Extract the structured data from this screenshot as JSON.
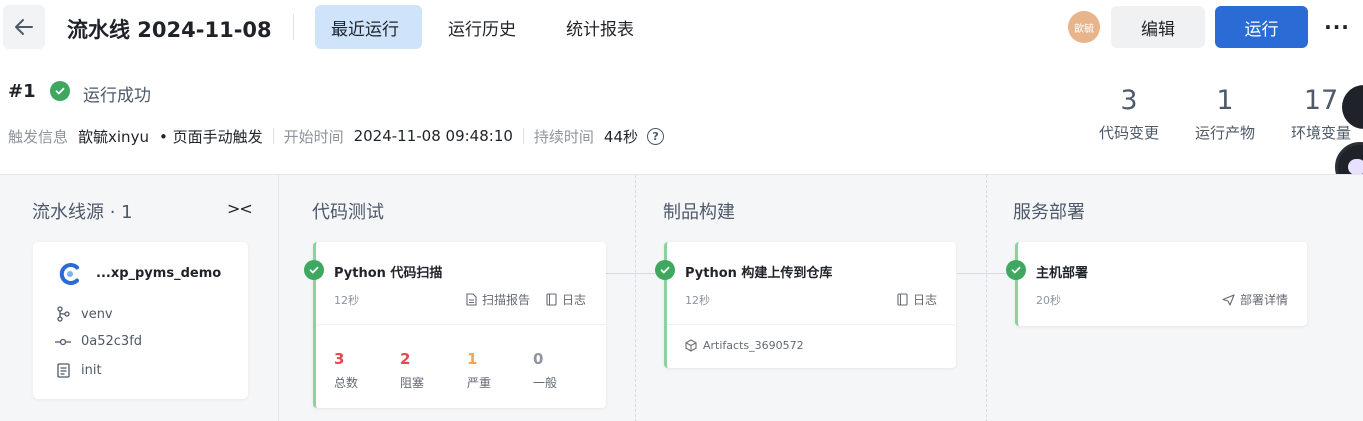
{
  "header": {
    "title": "流水线 2024-11-08",
    "tabs": [
      {
        "label": "最近运行",
        "active": true
      },
      {
        "label": "运行历史",
        "active": false
      },
      {
        "label": "统计报表",
        "active": false
      }
    ],
    "avatar_text": "歆毓",
    "edit_label": "编辑",
    "run_label": "运行",
    "more_label": "···"
  },
  "run": {
    "number": "#1",
    "status": "运行成功",
    "trigger_label": "触发信息",
    "trigger_user": "歆毓xinyu",
    "trigger_type": "• 页面手动触发",
    "start_label": "开始时间",
    "start_time": "2024-11-08 09:48:10",
    "duration_label": "持续时间",
    "duration": "44秒",
    "help_glyph": "?"
  },
  "stats": [
    {
      "value": "3",
      "label": "代码变更"
    },
    {
      "value": "1",
      "label": "运行产物"
    },
    {
      "value": "17",
      "label": "环境变量"
    }
  ],
  "source": {
    "title": "流水线源 · 1",
    "collapse_glyph": "><",
    "repo": "...xp_pyms_demo",
    "branch": "venv",
    "commit": "0a52c3fd",
    "message": "init"
  },
  "stages": [
    {
      "title": "代码测试",
      "job": {
        "name": "Python 代码扫描",
        "duration": "12秒",
        "links": [
          "扫描报告",
          "日志"
        ],
        "metrics": [
          {
            "value": "3",
            "label": "总数",
            "color": "#e5484d"
          },
          {
            "value": "2",
            "label": "阻塞",
            "color": "#e5484d"
          },
          {
            "value": "1",
            "label": "严重",
            "color": "#f5a356"
          },
          {
            "value": "0",
            "label": "一般",
            "color": "#8f959e"
          }
        ]
      }
    },
    {
      "title": "制品构建",
      "job": {
        "name": "Python 构建上传到仓库",
        "duration": "12秒",
        "links": [
          "日志"
        ],
        "artifact": "Artifacts_3690572"
      }
    },
    {
      "title": "服务部署",
      "job": {
        "name": "主机部署",
        "duration": "20秒",
        "links": [
          "部署详情"
        ]
      }
    }
  ],
  "colors": {
    "accent": "#2a6bd6",
    "success": "#3fa860",
    "tab_active_bg": "#cfe3fb"
  }
}
